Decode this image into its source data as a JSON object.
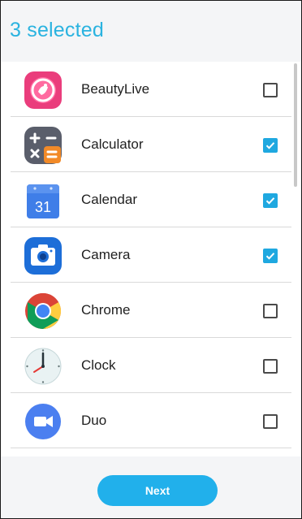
{
  "header": {
    "title": "3 selected"
  },
  "apps": [
    {
      "label": "BeautyLive",
      "checked": false,
      "icon": "beautylive-icon"
    },
    {
      "label": "Calculator",
      "checked": true,
      "icon": "calculator-icon"
    },
    {
      "label": "Calendar",
      "checked": true,
      "icon": "calendar-icon",
      "icon_text": "31"
    },
    {
      "label": "Camera",
      "checked": true,
      "icon": "camera-icon"
    },
    {
      "label": "Chrome",
      "checked": false,
      "icon": "chrome-icon"
    },
    {
      "label": "Clock",
      "checked": false,
      "icon": "clock-icon"
    },
    {
      "label": "Duo",
      "checked": false,
      "icon": "duo-icon"
    }
  ],
  "footer": {
    "next_label": "Next"
  },
  "colors": {
    "accent": "#21b0eb",
    "title": "#2ab3e0",
    "header_bg": "#f4f5f7"
  }
}
